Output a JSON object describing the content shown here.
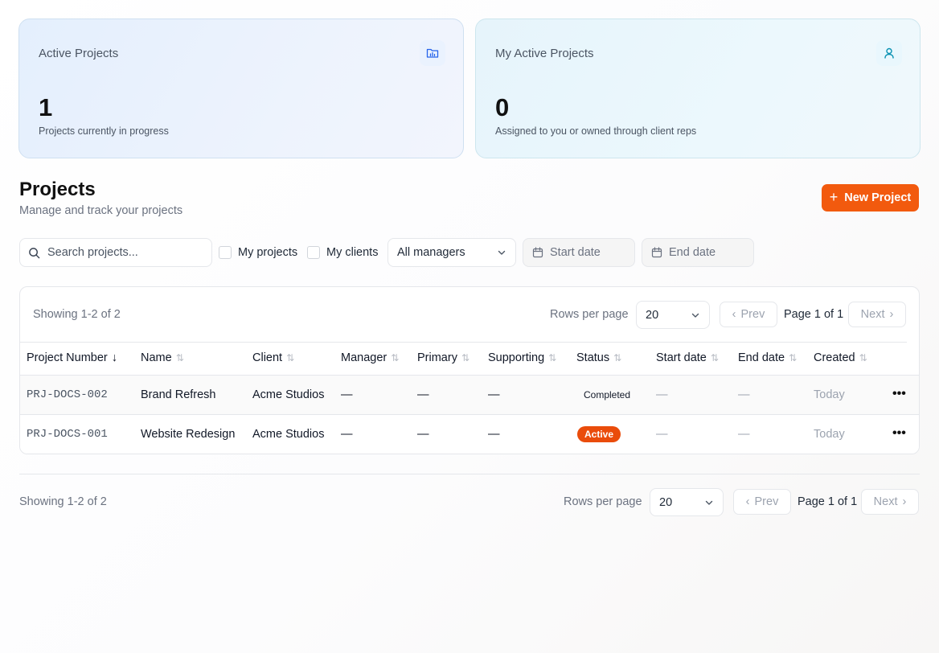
{
  "cards": [
    {
      "title": "Active Projects",
      "value": "1",
      "subtitle": "Projects currently in progress",
      "icon": "folder-chart-icon"
    },
    {
      "title": "My Active Projects",
      "value": "0",
      "subtitle": "Assigned to you or owned through client reps",
      "icon": "user-icon"
    }
  ],
  "header": {
    "title": "Projects",
    "subtitle": "Manage and track your projects",
    "new_button": "New Project"
  },
  "filters": {
    "search_placeholder": "Search projects...",
    "my_projects": "My projects",
    "my_clients": "My clients",
    "manager_select": "All managers",
    "start_date": "Start date",
    "end_date": "End date"
  },
  "pagination": {
    "showing": "Showing 1-2 of 2",
    "rows_per_page_label": "Rows per page",
    "rows_per_page": "20",
    "prev": "Prev",
    "page_info": "Page 1 of 1",
    "next": "Next"
  },
  "table": {
    "columns": [
      "Project Number",
      "Name",
      "Client",
      "Manager",
      "Primary",
      "Supporting",
      "Status",
      "Start date",
      "End date",
      "Created"
    ],
    "rows": [
      {
        "number": "PRJ-DOCS-002",
        "name": "Brand Refresh",
        "client": "Acme Studios",
        "manager": "—",
        "primary": "—",
        "supporting": "—",
        "status": "Completed",
        "start": "—",
        "end": "—",
        "created": "Today"
      },
      {
        "number": "PRJ-DOCS-001",
        "name": "Website Redesign",
        "client": "Acme Studios",
        "manager": "—",
        "primary": "—",
        "supporting": "—",
        "status": "Active",
        "start": "—",
        "end": "—",
        "created": "Today"
      }
    ],
    "row_action": "•••"
  },
  "colors": {
    "accent": "#f25a0e",
    "active_badge": "#ea4c0b",
    "card1_bg": "#e4effd",
    "card2_bg": "#e6f4fb"
  }
}
